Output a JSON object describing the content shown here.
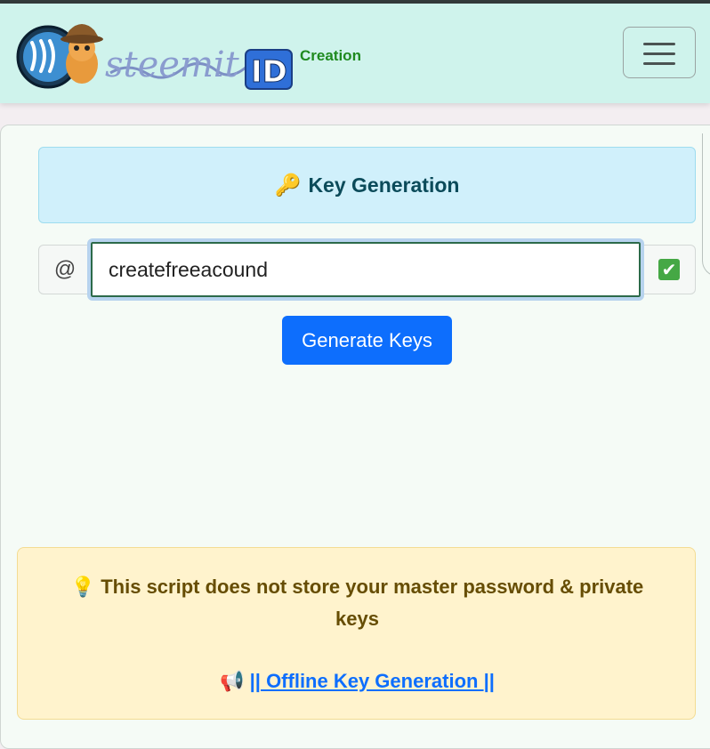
{
  "navbar": {
    "logo_text": "steemit",
    "logo_badge": "ID",
    "brand_sub": "Creation",
    "menu_icon": "hamburger-menu-icon"
  },
  "keygen": {
    "icon": "🔑",
    "title": "Key Generation"
  },
  "username": {
    "prefix": "@",
    "value": "createfreeacound",
    "status_icon": "✔"
  },
  "generate_button": {
    "label": "Generate Keys"
  },
  "notice": {
    "icon": "💡",
    "text": "This script does not store your master password & private keys",
    "link_icon": "📢",
    "link_prefix": "||",
    "link_text": " Offline Key Generation ",
    "link_suffix": "||"
  },
  "colors": {
    "navbar_bg": "#cff3ec",
    "brand_green": "#1f8a1f",
    "primary": "#0d6efd",
    "info_bg": "#d0f0fb",
    "warning_bg": "#fff3cd"
  }
}
